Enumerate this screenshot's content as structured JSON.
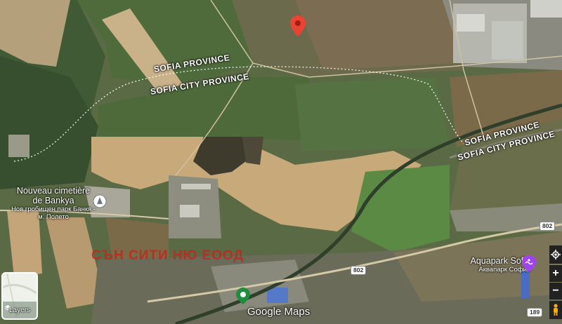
{
  "map": {
    "province_labels": [
      "SOFIA PROVINCE",
      "SOFIA CITY PROVINCE"
    ],
    "road_shields": [
      "802",
      "802",
      "189"
    ],
    "places": {
      "cemetery": {
        "name": "Nouveau cimetière de Bankya",
        "local_name": "Нов гробищен парк Банкя - м. Полето"
      },
      "aquapark": {
        "name": "Aquapark Sofia",
        "local_name": "Аквапарк София"
      }
    },
    "watermark": "СЪН СИТИ НЮ ЕООД",
    "attribution": "Google Maps",
    "layers_label": "Layers",
    "colors": {
      "pin": "#ea4335",
      "aquapark_pin": "#a142f4",
      "green_pin": "#1e8e3e",
      "watermark": "#c8241c"
    },
    "icons": {
      "location_pin": "red-location-pin-icon",
      "cemetery": "cemetery-icon",
      "aquapark": "aquapark-icon",
      "my_location": "my-location-icon",
      "zoom_in": "plus-icon",
      "zoom_out": "minus-icon",
      "street_view": "pegman-icon"
    },
    "controls": {
      "zoom_in": "+",
      "zoom_out": "−"
    }
  }
}
